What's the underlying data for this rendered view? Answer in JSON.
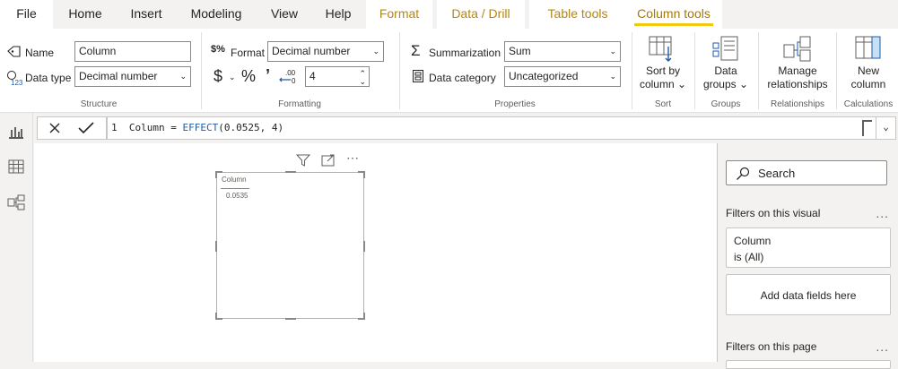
{
  "tabs": {
    "file": "File",
    "home": "Home",
    "insert": "Insert",
    "modeling": "Modeling",
    "view": "View",
    "help": "Help",
    "format": "Format",
    "data_drill": "Data / Drill",
    "table_tools": "Table tools",
    "column_tools": "Column tools"
  },
  "structure": {
    "name_label": "Name",
    "name_value": "Column",
    "datatype_label": "Data type",
    "datatype_value": "Decimal number",
    "group_label": "Structure"
  },
  "formatting": {
    "format_label": "Format",
    "format_value": "Decimal number",
    "currency_symbol": "$",
    "percent_symbol": "%",
    "comma_symbol": "’",
    "decimals_value": "4",
    "group_label": "Formatting"
  },
  "properties": {
    "summarization_label": "Summarization",
    "summarization_value": "Sum",
    "category_label": "Data category",
    "category_value": "Uncategorized",
    "group_label": "Properties"
  },
  "sort": {
    "line1": "Sort by",
    "line2": "column",
    "group_label": "Sort"
  },
  "groups": {
    "line1": "Data",
    "line2": "groups",
    "group_label": "Groups"
  },
  "relationships": {
    "line1": "Manage",
    "line2": "relationships",
    "group_label": "Relationships"
  },
  "calculations": {
    "line1": "New",
    "line2": "column",
    "group_label": "Calculations"
  },
  "formula": {
    "line_number": "1",
    "prefix": "Column = ",
    "function": "EFFECT",
    "args": "(0.0525, 4)"
  },
  "visual": {
    "header": "Column",
    "value": "0.0535"
  },
  "filters": {
    "search_placeholder": "Search",
    "on_visual": "Filters on this visual",
    "card_field": "Column",
    "card_state": "is (All)",
    "add_fields": "Add data fields here",
    "on_page": "Filters on this page",
    "more": "..."
  },
  "colors": {
    "accent": "#f2c811",
    "context_tab_text": "#b8860b",
    "keyword": "#1f5ba8"
  }
}
